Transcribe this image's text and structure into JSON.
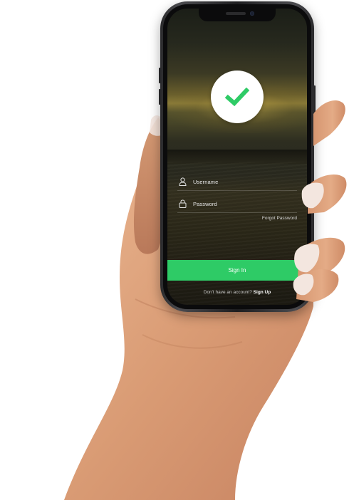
{
  "app": {
    "accent_color": "#2ecb66",
    "logo_icon": "checkmark-icon"
  },
  "form": {
    "username_placeholder": "Username",
    "username_icon": "user-icon",
    "password_placeholder": "Password",
    "password_icon": "lock-icon",
    "forgot_password_label": "Forgot Password"
  },
  "actions": {
    "sign_in_label": "Sign In",
    "no_account_text": "Don't have an account?",
    "sign_up_label": "Sign Up"
  }
}
